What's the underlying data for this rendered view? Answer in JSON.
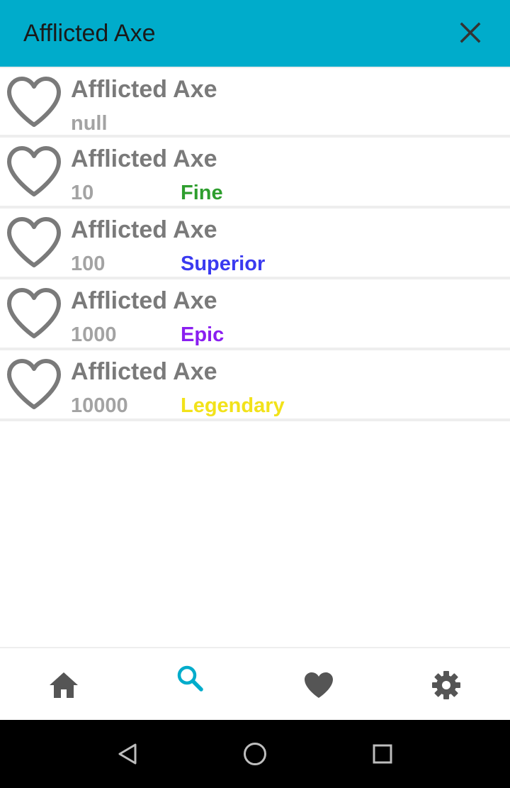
{
  "appbar": {
    "title": "Afflicted Axe",
    "close_icon": "close-icon",
    "background": "#00ACCB"
  },
  "items": [
    {
      "title": "Afflicted Axe",
      "value": "null",
      "rarity": "",
      "rarity_color": ""
    },
    {
      "title": "Afflicted Axe",
      "value": "10",
      "rarity": "Fine",
      "rarity_color": "#2E9E2E"
    },
    {
      "title": "Afflicted Axe",
      "value": "100",
      "rarity": "Superior",
      "rarity_color": "#3A3AF0"
    },
    {
      "title": "Afflicted Axe",
      "value": "1000",
      "rarity": "Epic",
      "rarity_color": "#8A1EF0"
    },
    {
      "title": "Afflicted Axe",
      "value": "10000",
      "rarity": "Legendary",
      "rarity_color": "#F2E21A"
    }
  ],
  "bottom_nav": {
    "items": [
      {
        "icon": "home-icon",
        "active": false
      },
      {
        "icon": "search-icon",
        "active": true
      },
      {
        "icon": "heart-icon",
        "active": false
      },
      {
        "icon": "gear-icon",
        "active": false
      }
    ],
    "active_color": "#00ACCB",
    "inactive_color": "#555555"
  },
  "system_nav": {
    "buttons": [
      "back-icon",
      "home-circle-icon",
      "recents-icon"
    ]
  }
}
